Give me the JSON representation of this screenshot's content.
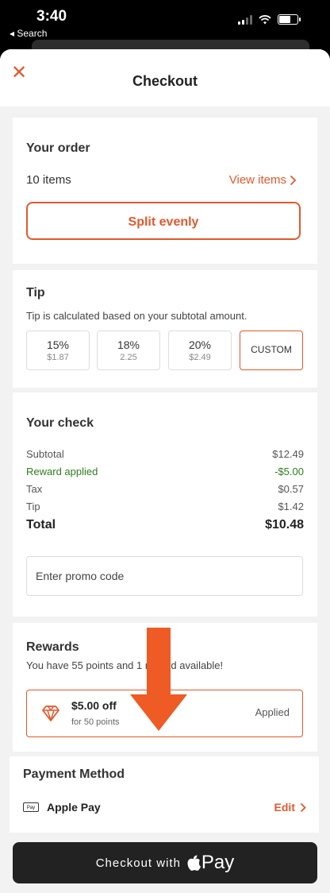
{
  "status_bar": {
    "time": "3:40",
    "back_label": "◂ Search"
  },
  "header": {
    "title": "Checkout"
  },
  "order": {
    "heading": "Your order",
    "items_count": "10 items",
    "view_items": "View items",
    "split_button": "Split evenly"
  },
  "tip": {
    "heading": "Tip",
    "subtitle": "Tip is calculated based on your subtotal amount.",
    "options": [
      {
        "percent": "15%",
        "amount": "$1.87"
      },
      {
        "percent": "18%",
        "amount": "2.25"
      },
      {
        "percent": "20%",
        "amount": "$2.49"
      }
    ],
    "custom_label": "CUSTOM"
  },
  "check": {
    "heading": "Your check",
    "rows": [
      {
        "label": "Subtotal",
        "value": "$12.49"
      },
      {
        "label": "Reward applied",
        "value": "-$5.00"
      },
      {
        "label": "Tax",
        "value": "$0.57"
      },
      {
        "label": "Tip",
        "value": "$1.42"
      }
    ],
    "total_label": "Total",
    "total_value": "$10.48",
    "promo_placeholder": "Enter promo code"
  },
  "rewards": {
    "heading": "Rewards",
    "subtitle": "You have 55 points and 1 reward available!",
    "reward_title": "$5.00 off",
    "reward_subtitle": "for 50 points",
    "reward_status": "Applied"
  },
  "payment": {
    "heading": "Payment Method",
    "badge": "Pay",
    "method": "Apple Pay",
    "edit_label": "Edit"
  },
  "checkout": {
    "label": "Checkout with",
    "pay_label": "Pay"
  },
  "colors": {
    "accent": "#e2582c",
    "success": "#2e7d1f",
    "button_bg": "#222222"
  }
}
